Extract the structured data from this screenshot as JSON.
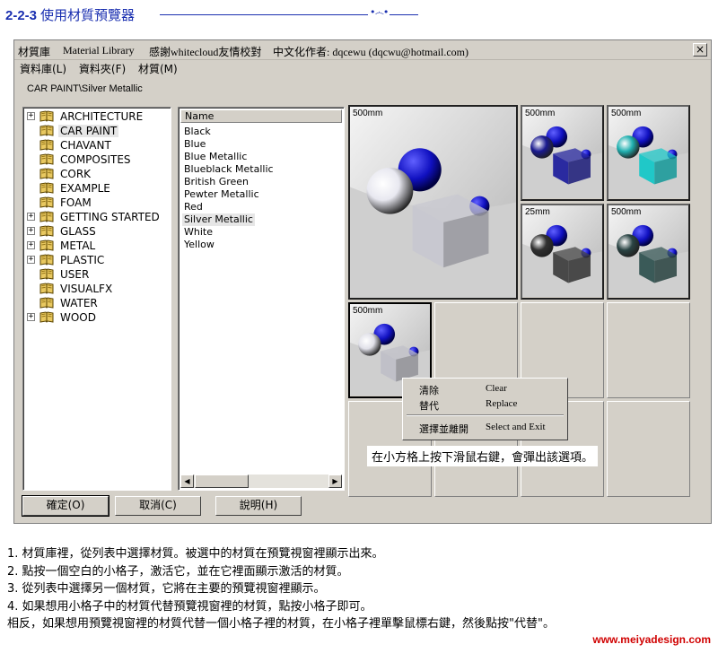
{
  "header": {
    "section_number": "2-2-3",
    "section_title": "使用材質預覽器"
  },
  "window": {
    "title_parts": [
      "材質庫",
      "Material Library",
      "感謝whitecloud友情校對",
      "中文化作者: dqcewu (dqcwu@hotmail.com)"
    ],
    "close_label": "×",
    "menu": [
      "資料庫(L)",
      "資料夾(F)",
      "材質(M)"
    ],
    "path": "CAR PAINT\\Silver Metallic"
  },
  "tree": {
    "items": [
      {
        "label": "ARCHITECTURE",
        "expandable": true
      },
      {
        "label": "CAR PAINT",
        "expandable": false,
        "selected": true
      },
      {
        "label": "CHAVANT",
        "expandable": false
      },
      {
        "label": "COMPOSITES",
        "expandable": false
      },
      {
        "label": "CORK",
        "expandable": false
      },
      {
        "label": "EXAMPLE",
        "expandable": false
      },
      {
        "label": "FOAM",
        "expandable": false
      },
      {
        "label": "GETTING STARTED",
        "expandable": true
      },
      {
        "label": "GLASS",
        "expandable": true
      },
      {
        "label": "METAL",
        "expandable": true
      },
      {
        "label": "PLASTIC",
        "expandable": true
      },
      {
        "label": "USER",
        "expandable": false
      },
      {
        "label": "VISUALFX",
        "expandable": false
      },
      {
        "label": "WATER",
        "expandable": false
      },
      {
        "label": "WOOD",
        "expandable": true
      }
    ]
  },
  "names": {
    "header": "Name",
    "items": [
      "Black",
      "Blue",
      "Blue Metallic",
      "Blueblack Metallic",
      "British Green",
      "Pewter Metallic",
      "Red",
      "Silver Metallic",
      "White",
      "Yellow"
    ],
    "selected": "Silver Metallic"
  },
  "buttons": {
    "ok": "確定(O)",
    "cancel": "取消(C)",
    "help": "說明(H)"
  },
  "previews": {
    "main": {
      "size": "500mm",
      "cube": "#c8c8d0"
    },
    "thumbs": [
      {
        "size": "500mm",
        "cube": "#2a2aa0",
        "sphere": "#1a1a90"
      },
      {
        "size": "500mm",
        "cube": "#20c8c8",
        "sphere": "#20b0b0"
      },
      {
        "size": "25mm",
        "cube": "#484848",
        "sphere": "#303030"
      },
      {
        "size": "500mm",
        "cube": "#3a5a58",
        "sphere": "#2a4444"
      },
      {
        "size": "500mm",
        "cube": "#c0c0c8",
        "sphere": "#e0e0e8"
      }
    ]
  },
  "context_menu": {
    "items": [
      {
        "zh": "清除",
        "en": "Clear"
      },
      {
        "zh": "替代",
        "en": "Replace"
      },
      {
        "zh": "選擇並離開",
        "en": "Select and Exit"
      }
    ]
  },
  "hint": "在小方格上按下滑鼠右鍵，會彈出該選項。",
  "steps": [
    " 1. 材質庫裡，從列表中選擇材質。被選中的材質在預覽視窗裡顯示出來。",
    " 2. 點按一個空白的小格子，激活它，並在它裡面顯示激活的材質。",
    " 3. 從列表中選擇另一個材質，它將在主要的預覽視窗裡顯示。",
    " 4. 如果想用小格子中的材質代替預覽視窗裡的材質，點按小格子即可。",
    "相反，如果想用預覽視窗裡的材質代替一個小格子裡的材質，在小格子裡單擊鼠標右鍵，然後點按\"代替\"。"
  ],
  "watermark": "www.meiyadesign.com"
}
